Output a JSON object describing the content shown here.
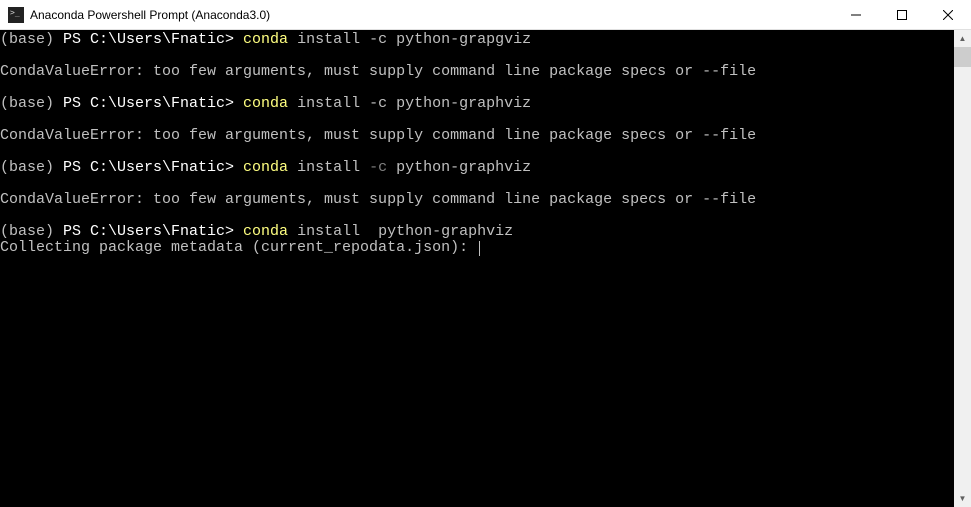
{
  "window": {
    "title": "Anaconda Powershell Prompt (Anaconda3.0)"
  },
  "terminal": {
    "prompt_env": "(base) ",
    "prompt_path": "PS C:\\Users\\Fnatic> ",
    "cmd_word": "conda",
    "lines": [
      {
        "cmd_rest": " install -c python-grapgviz"
      },
      {
        "error": "CondaValueError: too few arguments, must supply command line package specs or --file"
      },
      {
        "cmd_rest": " install -c python-graphviz"
      },
      {
        "error": "CondaValueError: too few arguments, must supply command line package specs or --file"
      },
      {
        "cmd_rest_a": " install ",
        "dim": "-c",
        "cmd_rest_b": " python-graphviz"
      },
      {
        "error": "CondaValueError: too few arguments, must supply command line package specs or --file"
      },
      {
        "cmd_rest": " install  python-graphviz"
      }
    ],
    "status": "Collecting package metadata (current_repodata.json): "
  }
}
